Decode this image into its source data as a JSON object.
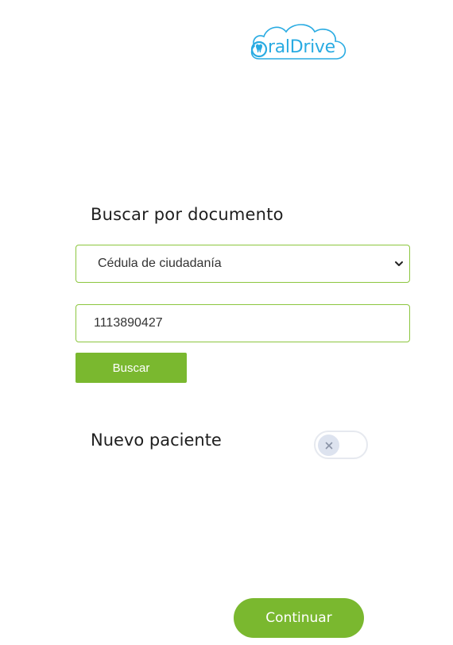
{
  "brand": {
    "logo_prefix": "O",
    "logo_text": "ralDrive",
    "colors": {
      "logo_blue": "#29abe2",
      "logo_green": "#8cc63f",
      "accent_green": "#7ab82f",
      "field_border": "#8cc63f"
    }
  },
  "search": {
    "title": "Buscar por documento",
    "document_type_selected": "Cédula de ciudadanía",
    "document_number_value": "1113890427",
    "search_button_label": "Buscar"
  },
  "new_patient": {
    "label": "Nuevo paciente",
    "toggle_on": false
  },
  "footer": {
    "continue_label": "Continuar"
  },
  "icons": {
    "select_arrow": "chevron-down-icon",
    "toggle_off": "close-icon"
  }
}
